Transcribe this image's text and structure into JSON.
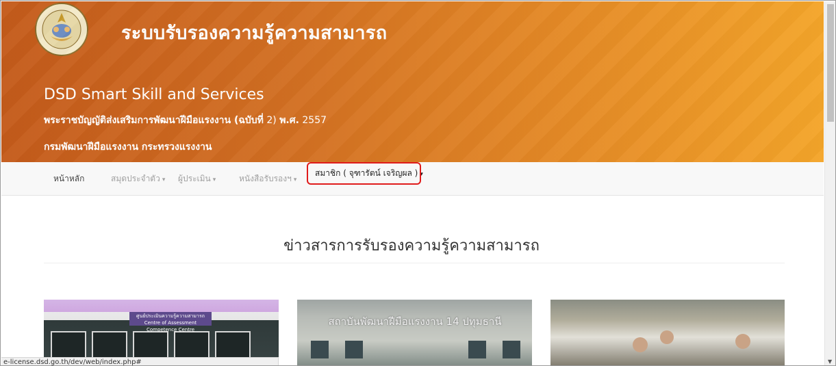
{
  "header": {
    "title": "ระบบรับรองความรู้ความสามารถ",
    "subtitle": "DSD Smart Skill and Services",
    "act_bold": "พระราชบัญญัติส่งเสริมการพัฒนาฝีมือแรงงาน (ฉบับที่",
    "act_light": " 2) ",
    "act_bold2": "พ.ศ.",
    "act_year": " 2557",
    "department": "กรมพัฒนาฝีมือแรงงาน กระทรวงแรงงาน"
  },
  "navbar": {
    "items": [
      {
        "label": "หน้าหลัก"
      },
      {
        "label": "สมุดประจำตัว"
      },
      {
        "label": "ผู้ประเมิน"
      },
      {
        "label": "หนังสือรับรองฯ"
      },
      {
        "label": "สมาชิก ( จุฑารัตน์ เจริญผล )"
      }
    ],
    "caret": "▾"
  },
  "content": {
    "section_title": "ข่าวสารการรับรองความรู้ความสามารถ",
    "news": [
      {
        "image_text": "ศูนย์ประเมินความรู้ความสามารถ",
        "image_subtext": "Centre of Assessment Competence Centre"
      },
      {
        "image_text": "สถาบันพัฒนาฝีมือแรงงาน 14 ปทุมธานี"
      },
      {}
    ]
  },
  "status_bar": {
    "url": "e-license.dsd.go.th/dev/web/index.php#"
  },
  "colors": {
    "banner_start": "#c45b1b",
    "banner_end": "#f4a52a",
    "highlight": "#e01b1b"
  }
}
